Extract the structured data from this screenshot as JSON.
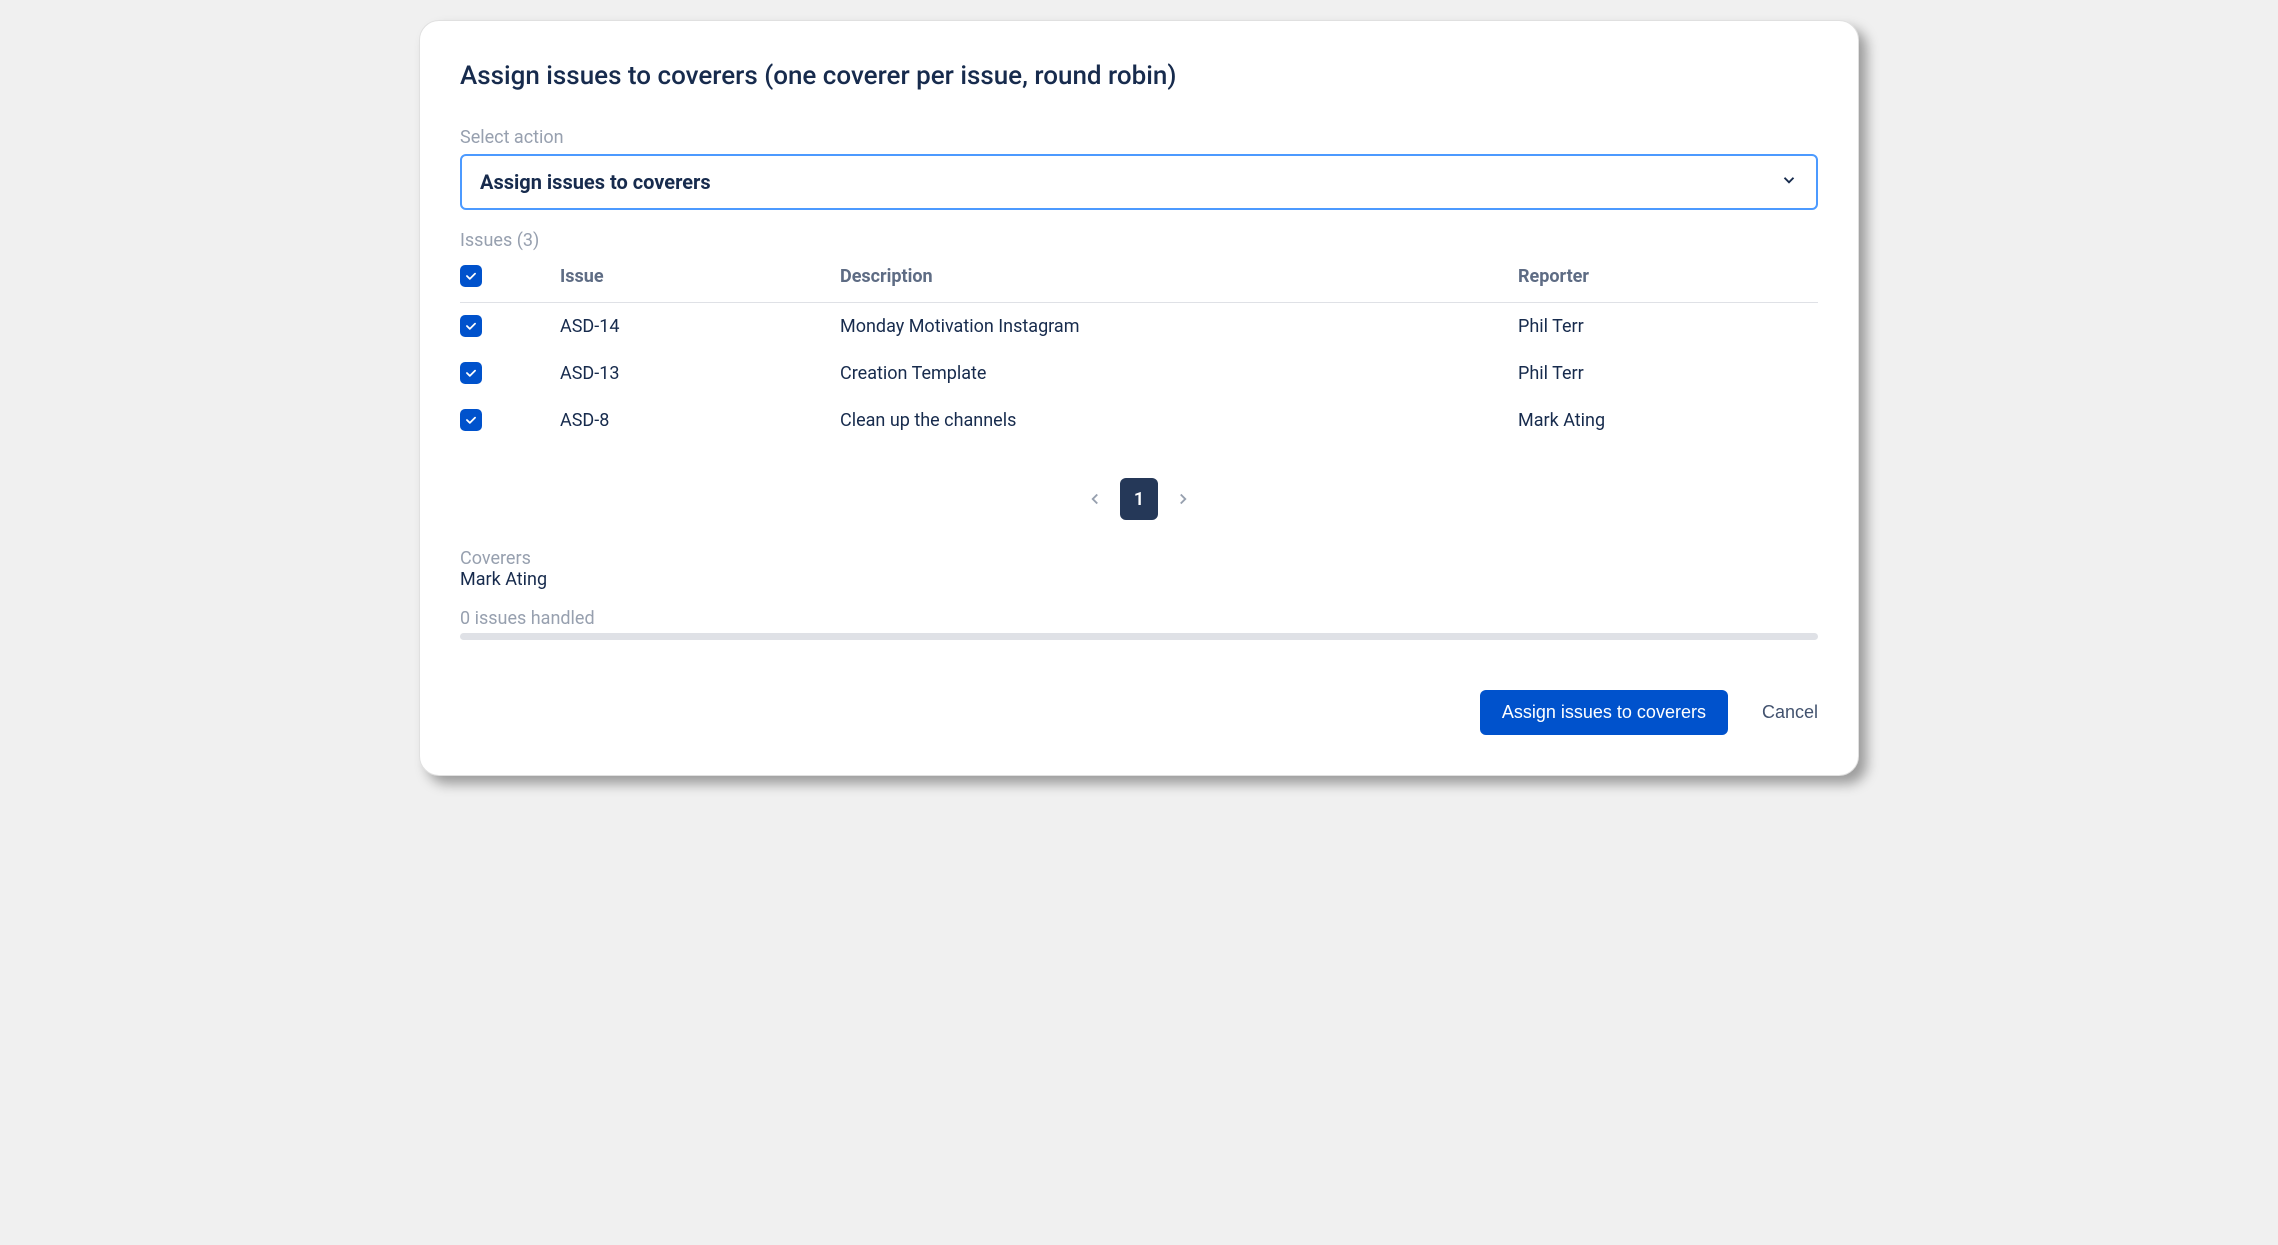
{
  "title": "Assign issues to coverers (one coverer per issue, round robin)",
  "action_field": {
    "label": "Select action",
    "value": "Assign issues to coverers"
  },
  "issues": {
    "label": "Issues (3)",
    "columns": {
      "issue": "Issue",
      "description": "Description",
      "reporter": "Reporter"
    },
    "rows": [
      {
        "checked": true,
        "id": "ASD-14",
        "description": "Monday Motivation Instagram",
        "reporter": "Phil Terr"
      },
      {
        "checked": true,
        "id": "ASD-13",
        "description": "Creation Template",
        "reporter": "Phil Terr"
      },
      {
        "checked": true,
        "id": "ASD-8",
        "description": "Clean up the channels",
        "reporter": "Mark Ating"
      }
    ]
  },
  "pagination": {
    "current": "1"
  },
  "coverers": {
    "label": "Coverers",
    "name": "Mark Ating"
  },
  "progress": {
    "label": "0 issues handled"
  },
  "buttons": {
    "primary": "Assign issues to coverers",
    "cancel": "Cancel"
  }
}
